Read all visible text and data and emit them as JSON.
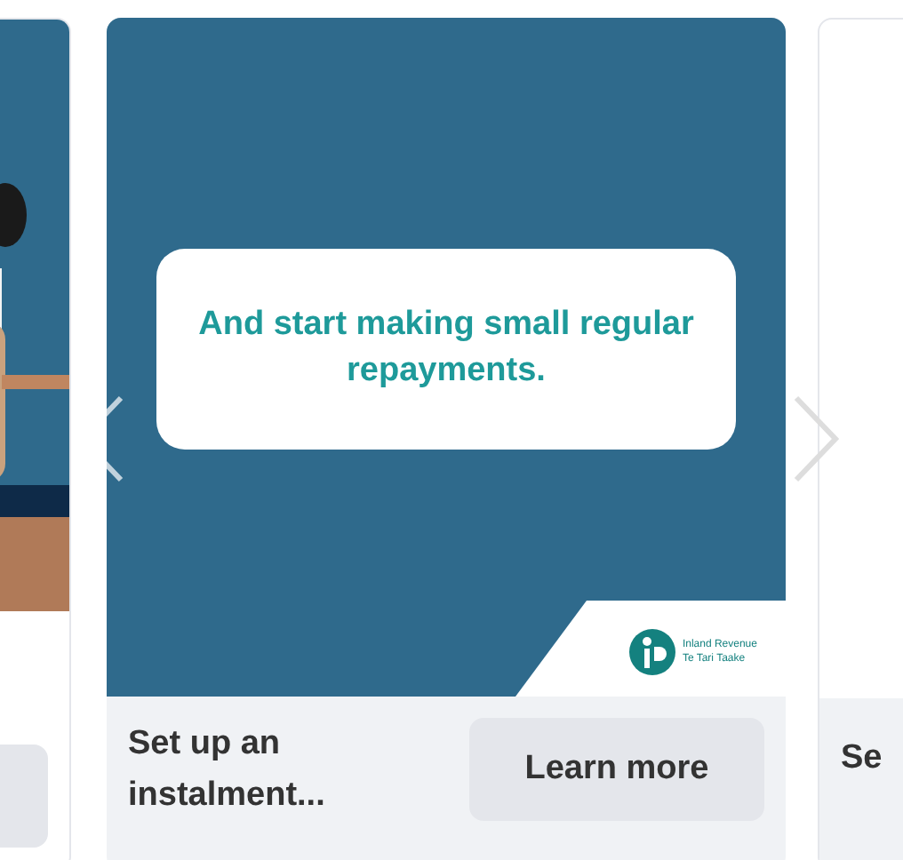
{
  "carousel": {
    "cards": [
      {
        "kind": "partial"
      },
      {
        "kind": "full",
        "headline": "And start making small regular repayments.",
        "brand_lines": [
          "Inland Revenue",
          "Te Tari Taake"
        ],
        "title": "Set up an instalment...",
        "button": "Learn more"
      },
      {
        "kind": "cut",
        "title": "Se"
      }
    ]
  }
}
